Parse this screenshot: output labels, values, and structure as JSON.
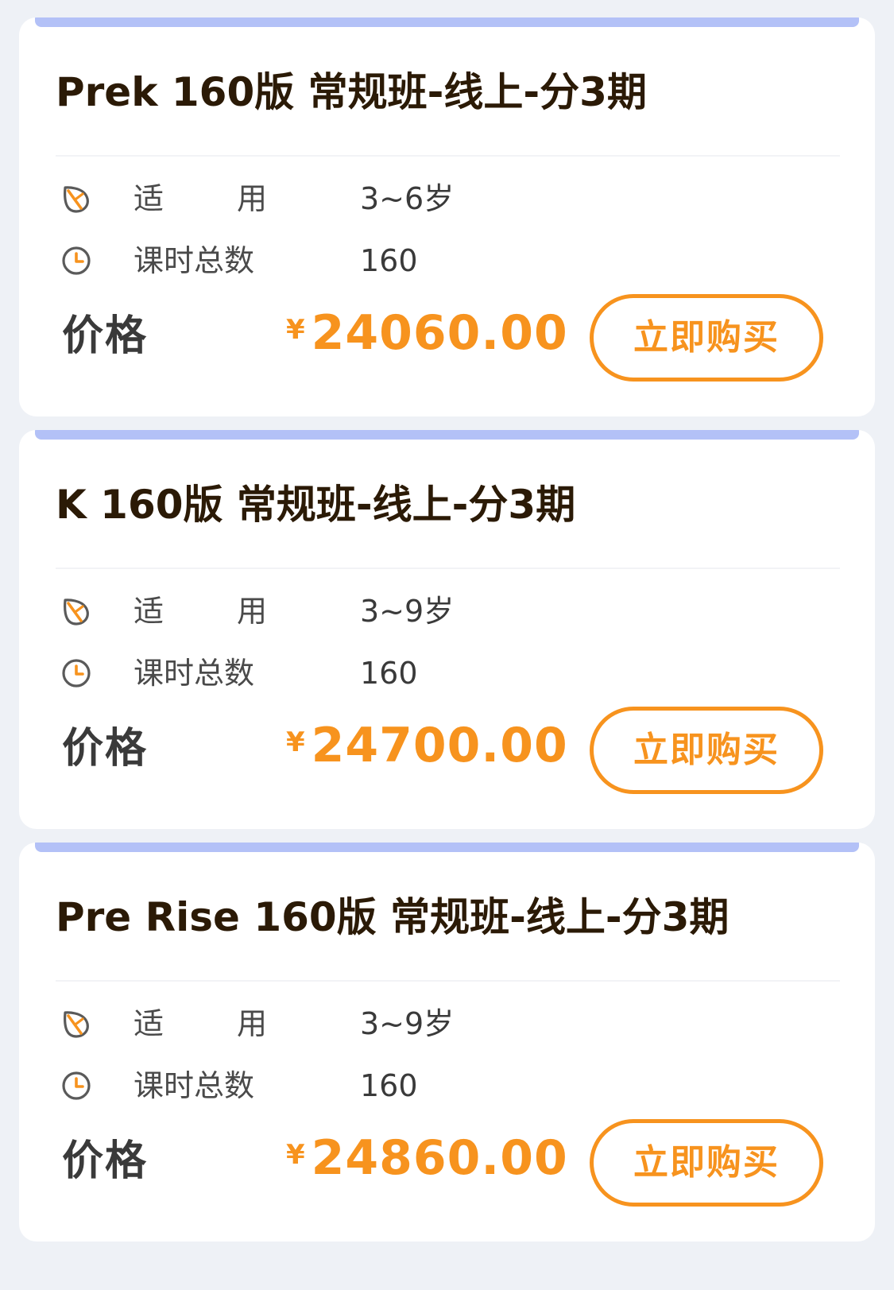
{
  "cards": [
    {
      "title": "Prek 160版 常规班-线上-分3期",
      "age_label": [
        "适",
        "用"
      ],
      "age_value": "3~6岁",
      "hours_label": "课时总数",
      "hours_value": "160",
      "price_label": "价格",
      "currency": "¥",
      "price": "24060.00",
      "buy_label": "立即购买"
    },
    {
      "title": "K 160版 常规班-线上-分3期",
      "age_label": [
        "适",
        "用"
      ],
      "age_value": "3~9岁",
      "hours_label": "课时总数",
      "hours_value": "160",
      "price_label": "价格",
      "currency": "¥",
      "price": "24700.00",
      "buy_label": "立即购买"
    },
    {
      "title": "Pre Rise 160版 常规班-线上-分3期",
      "age_label": [
        "适",
        "用"
      ],
      "age_value": "3~9岁",
      "hours_label": "课时总数",
      "hours_value": "160",
      "price_label": "价格",
      "currency": "¥",
      "price": "24860.00",
      "buy_label": "立即购买"
    }
  ],
  "colors": {
    "accent": "#f7931e",
    "card_topbar": "#b3c1f7",
    "background": "#eef1f6",
    "title_text": "#2b1a06"
  },
  "icons": {
    "age": "leaf-icon",
    "hours": "clock-icon"
  }
}
